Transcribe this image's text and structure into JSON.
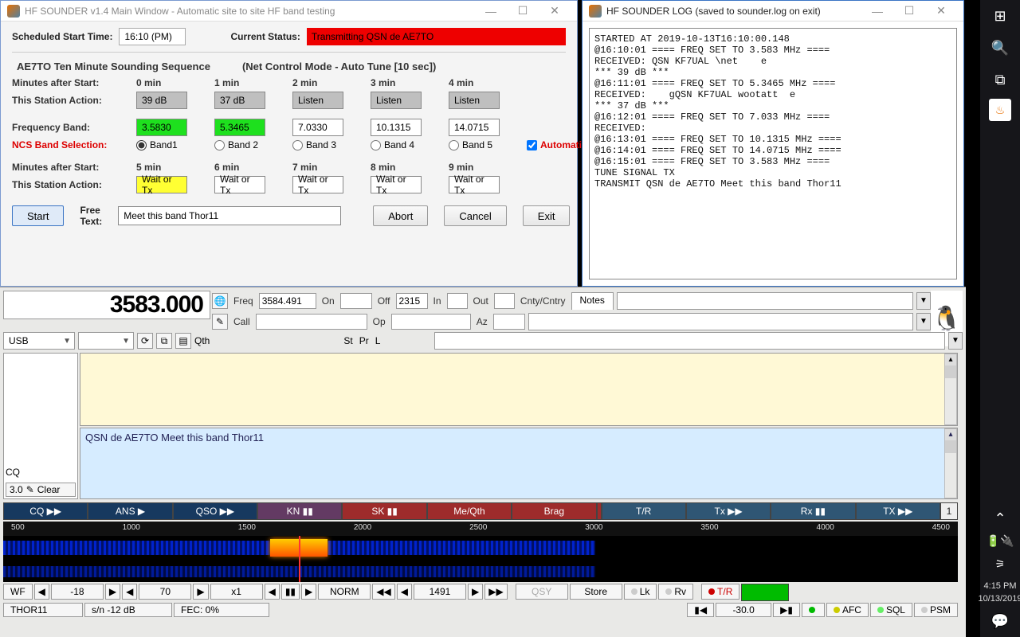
{
  "main": {
    "title": "HF SOUNDER v1.4 Main Window - Automatic site to site HF band testing",
    "sched_label": "Scheduled Start Time:",
    "sched_value": "16:10 (PM)",
    "status_label": "Current Status:",
    "status_value": "Transmitting QSN de AE7TO",
    "seq_title": "AE7TO  Ten Minute Sounding Sequence",
    "net_mode": "(Net Control Mode - Auto Tune [10 sec])",
    "r_min_after": "Minutes after Start:",
    "r_action": "This Station Action:",
    "r_freq": "Frequency Band:",
    "r_band_sel": "NCS Band Selection:",
    "mins_a": [
      "0 min",
      "1 min",
      "2 min",
      "3 min",
      "4 min"
    ],
    "act_a": [
      "39 dB",
      "37 dB",
      "Listen",
      "Listen",
      "Listen"
    ],
    "freq": [
      "3.5830",
      "5.3465",
      "7.0330",
      "10.1315",
      "14.0715"
    ],
    "bands": [
      "Band1",
      "Band 2",
      "Band 3",
      "Band 4",
      "Band 5"
    ],
    "auto": "Automatic",
    "mins_b": [
      "5 min",
      "6 min",
      "7 min",
      "8 min",
      "9 min"
    ],
    "act_b": [
      "Wait or Tx",
      "Wait or Tx",
      "Wait or Tx",
      "Wait or Tx",
      "Wait or Tx"
    ],
    "btn_start": "Start",
    "free_label": "Free Text:",
    "free_value": "Meet this band Thor11",
    "btn_abort": "Abort",
    "btn_cancel": "Cancel",
    "btn_exit": "Exit"
  },
  "log": {
    "title": "HF SOUNDER LOG (saved to sounder.log on exit)",
    "text": "STARTED AT 2019-10-13T16:10:00.148\n@16:10:01 ==== FREQ SET TO 3.583 MHz ====\nRECEIVED: QSN KF7UAL \\net    e\n*** 39 dB ***\n@16:11:01 ==== FREQ SET TO 5.3465 MHz ====\nRECEIVED:    gQSN KF7UAL wootatt  e\n*** 37 dB ***\n@16:12:01 ==== FREQ SET TO 7.033 MHz ====\nRECEIVED:\n@16:13:01 ==== FREQ SET TO 10.1315 MHz ====\n@16:14:01 ==== FREQ SET TO 14.0715 MHz ====\n@16:15:01 ==== FREQ SET TO 3.583 MHz ====\nTUNE SIGNAL TX\nTRANSMIT QSN de AE7TO Meet this band Thor11"
  },
  "radio": {
    "bigfreq": "3583.000",
    "mode": "USB",
    "f_freq_l": "Freq",
    "f_freq": "3584.491",
    "f_on": "On",
    "f_off": "Off",
    "f_off_v": "2315",
    "f_in": "In",
    "f_out": "Out",
    "f_cnty": "Cnty/Cntry",
    "f_call": "Call",
    "f_op": "Op",
    "f_az": "Az",
    "f_qth": "Qth",
    "f_st": "St",
    "f_pr": "Pr",
    "f_l": "L",
    "tab_notes": "Notes",
    "txline": "QSN de AE7TO Meet this band Thor11",
    "cq": "CQ",
    "clear": "Clear",
    "clear_pre": "3.0",
    "macros": [
      "CQ ▶▶",
      "ANS ▶",
      "QSO ▶▶",
      "KN ▮▮",
      "SK ▮▮",
      "Me/Qth",
      "Brag",
      "T/R",
      "Tx ▶▶",
      "Rx ▮▮",
      "TX ▶▶"
    ],
    "macnum": "1",
    "ruler": [
      "500",
      "1000",
      "1500",
      "2000",
      "2500",
      "3000",
      "3500",
      "4000",
      "4500"
    ],
    "ctrl": {
      "wf": "WF",
      "val1": "-18",
      "val2": "70",
      "zoom": "x1",
      "norm": "NORM",
      "cursor": "1491",
      "qsy": "QSY",
      "store": "Store",
      "lk": "Lk",
      "rv": "Rv",
      "tr": "T/R"
    },
    "status": {
      "mode": "THOR11",
      "sn": "s/n -12 dB",
      "fec": "FEC:    0%",
      "val": "-30.0",
      "afc": "AFC",
      "sql": "SQL",
      "psm": "PSM"
    }
  },
  "tray": {
    "time": "4:15 PM",
    "date": "10/13/2019"
  }
}
